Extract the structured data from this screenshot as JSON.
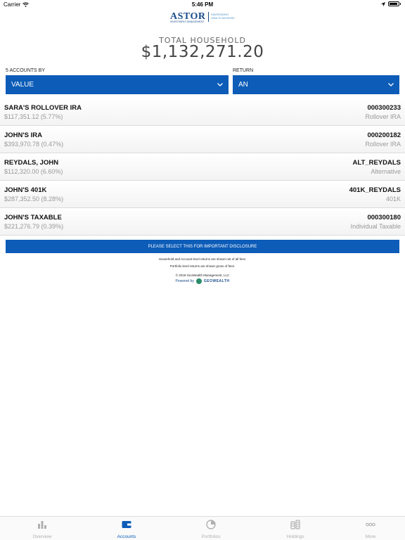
{
  "status_bar": {
    "carrier": "Carrier",
    "time": "5:46 PM"
  },
  "logo": {
    "word": "ASTOR",
    "sub": "INVESTMENT MANAGEMENT",
    "tag": "INDEPENDENT WEALTH ADVISORS"
  },
  "household": {
    "label": "TOTAL HOUSEHOLD",
    "value": "$1,132,271.20"
  },
  "filters": {
    "accounts_by_label": "5 ACCOUNTS BY",
    "accounts_by_value": "VALUE",
    "return_label": "RETURN",
    "return_value": "AN"
  },
  "accounts": [
    {
      "name": "SARA'S ROLLOVER IRA",
      "value": "$117,351.12 (5.77%)",
      "number": "000300233",
      "type": "Rollover IRA"
    },
    {
      "name": "JOHN'S IRA",
      "value": "$393,970.78 (0.47%)",
      "number": "000200182",
      "type": "Rollover IRA"
    },
    {
      "name": "REYDALS, JOHN",
      "value": "$112,320.00 (6.60%)",
      "number": "ALT_REYDALS",
      "type": "Alternative"
    },
    {
      "name": "JOHN'S 401K",
      "value": "$287,352.50 (8.28%)",
      "number": "401K_REYDALS",
      "type": "401K"
    },
    {
      "name": "JOHN'S TAXABLE",
      "value": "$221,276.79 (0.39%)",
      "number": "000300180",
      "type": "Individual Taxable"
    }
  ],
  "disclosure": {
    "button": "PLEASE SELECT THIS FOR IMPORTANT DISCLOSURE",
    "note1": "Household and Account level returns are shown net of all fees.",
    "note2": "Portfolio level returns are shown gross of fees.",
    "copyright": "© 2018 GeoWealth Management, LLC",
    "powered_by": "Powered by",
    "powered_brand": "GEOWEALTH"
  },
  "tabs": [
    {
      "label": "Overview",
      "icon": "bar-chart-icon"
    },
    {
      "label": "Accounts",
      "icon": "wallet-icon"
    },
    {
      "label": "Portfolios",
      "icon": "pie-chart-icon"
    },
    {
      "label": "Holdings",
      "icon": "coin-stack-icon"
    },
    {
      "label": "More",
      "icon": "more-dots-icon"
    }
  ],
  "colors": {
    "accent": "#0c5cb8",
    "inactive_tab": "#b0b0b0"
  }
}
